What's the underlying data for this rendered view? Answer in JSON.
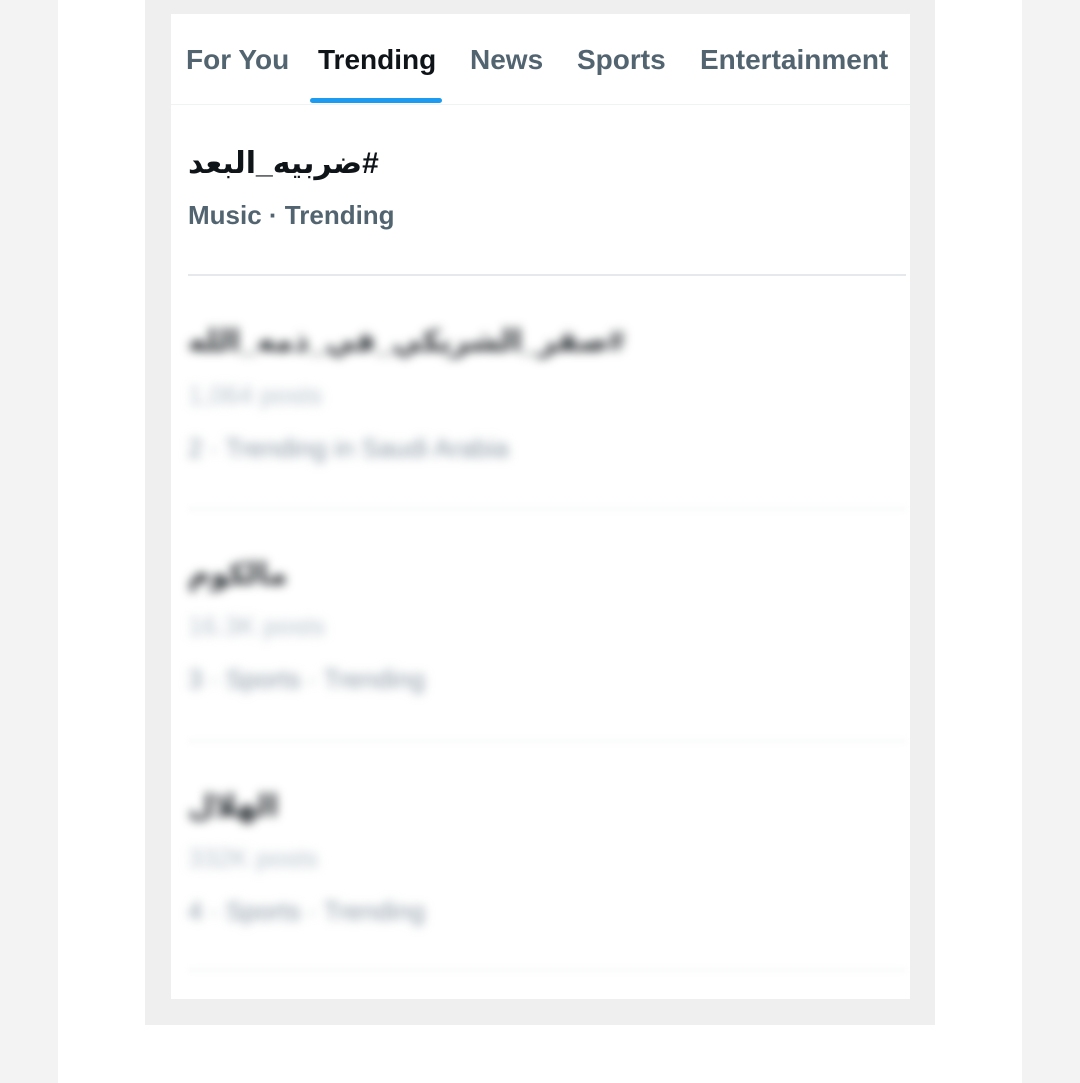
{
  "tabs": [
    {
      "label": "For You",
      "active": false
    },
    {
      "label": "Trending",
      "active": true
    },
    {
      "label": "News",
      "active": false
    },
    {
      "label": "Sports",
      "active": false
    },
    {
      "label": "Entertainment",
      "active": false
    }
  ],
  "accent_color": "#1d9bf0",
  "trends": [
    {
      "title": "#ضربيه_البعد",
      "meta": "Music · Trending"
    },
    {
      "title": "#صقر_الشريكي_في_ذمه_الله",
      "posts": "1,064 posts",
      "meta": "2 · Trending in Saudi Arabia"
    },
    {
      "title": "مالكوم",
      "posts": "16.3K posts",
      "meta": "3 · Sports · Trending"
    },
    {
      "title": "الهلال",
      "posts": "332K posts",
      "meta": "4 · Sports · Trending"
    }
  ]
}
